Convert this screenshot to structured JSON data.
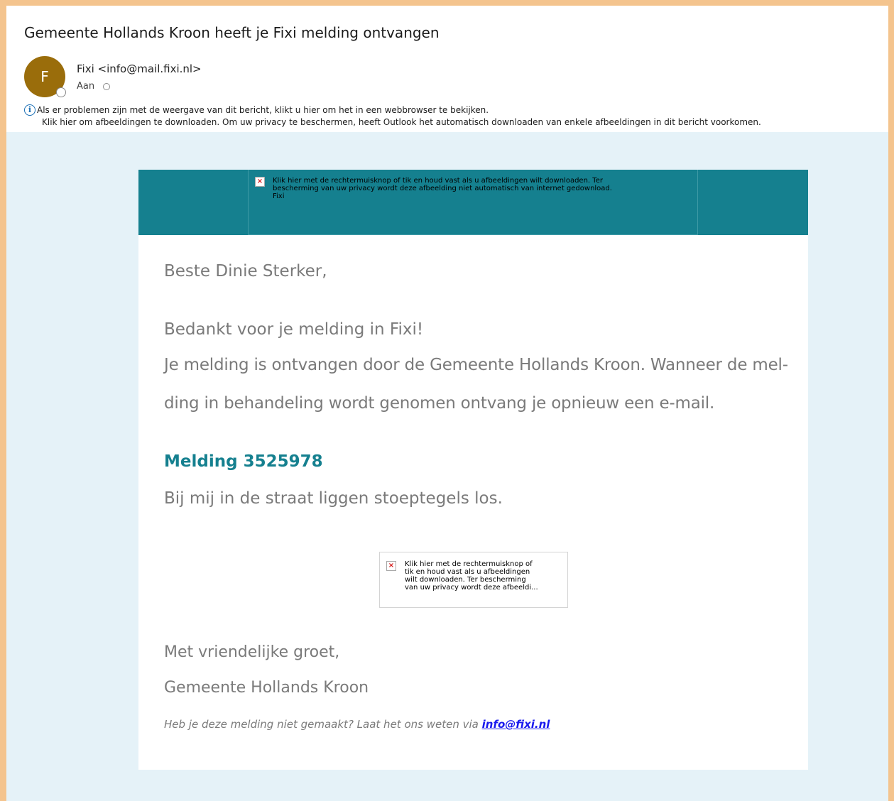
{
  "email": {
    "subject": "Gemeente Hollands Kroon heeft je Fixi melding ontvangen",
    "avatar_initial": "F",
    "sender": "Fixi <info@mail.fixi.nl>",
    "to_label": "Aan",
    "info_line_1": "Als er problemen zijn met de weergave van dit bericht, klikt u hier om het in een webbrowser te bekijken.",
    "info_line_2": "Klik hier om afbeeldingen te downloaden. Om uw privacy te beschermen, heeft Outlook het automatisch downloaden van enkele afbeeldingen in dit bericht voorkomen."
  },
  "banner_placeholder": {
    "line1": "Klik hier met de rechtermuisknop of tik en houd vast als u afbeeldingen wilt downloaden. Ter",
    "line2": "bescherming van uw privacy wordt deze afbeelding niet automatisch van internet gedownload.",
    "line3": "Fixi"
  },
  "content": {
    "greeting": "Beste Dinie Sterker,",
    "thanks": "Bedankt voor je melding in Fixi!",
    "received_line1": "Je melding is ontvangen door de Gemeente Hollands Kroon. Wanneer de mel-",
    "received_line2": "ding in behandeling wordt genomen ontvang je opnieuw een e-mail.",
    "melding_title": "Melding 3525978",
    "melding_description": "Bij mij in de straat liggen stoeptegels los.",
    "regards": "Met vriendelijke groet,",
    "organisation": "Gemeente Hollands Kroon",
    "footer_text": "Heb je deze melding niet gemaakt? Laat het ons weten via ",
    "footer_link": "info@fixi.nl"
  },
  "inline_placeholder": {
    "line1": "Klik hier met de rechtermuisknop of",
    "line2": "tik en houd vast als u afbeeldingen",
    "line3": "wilt downloaden. Ter bescherming",
    "line4": "van uw privacy wordt deze afbeeldi..."
  },
  "colors": {
    "accent": "#15808f",
    "avatar": "#9a6d0b",
    "body_background": "#e5f2f8",
    "outer_border": "#f4c48e",
    "link": "#1a1aee"
  }
}
